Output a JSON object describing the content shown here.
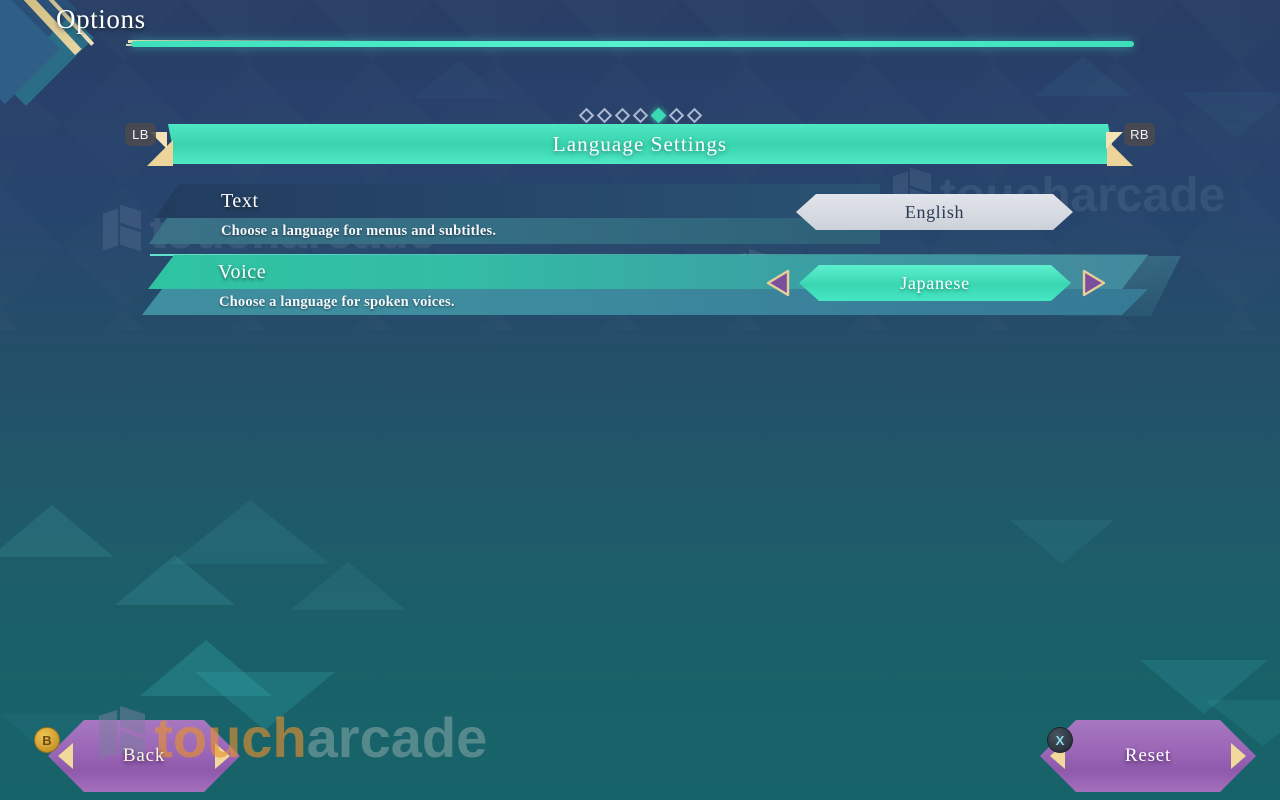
{
  "header": {
    "page_title": "Options",
    "category_title": "Language Settings",
    "left_bumper": "LB",
    "right_bumper": "RB",
    "tab_count": 7,
    "active_tab_index": 4
  },
  "settings": [
    {
      "id": "text",
      "label": "Text",
      "description": "Choose a language for menus and subtitles.",
      "value": "English",
      "selected": false
    },
    {
      "id": "voice",
      "label": "Voice",
      "description": "Choose a language for spoken voices.",
      "value": "Japanese",
      "selected": true
    }
  ],
  "stepper": {
    "prev_icon": "triangle-left-icon",
    "next_icon": "triangle-right-icon"
  },
  "footer": {
    "back_label": "Back",
    "back_badge": "B",
    "reset_label": "Reset",
    "reset_badge": "X"
  },
  "watermark": {
    "part_one": "touch",
    "part_two": "arcade",
    "logo_icon": "toucharcade-logo-icon"
  },
  "colors": {
    "accent_teal": "#3ad6b2",
    "banner_teal": "#46e6c4",
    "gold": "#ecd49a",
    "purple_button": "#9a66b6",
    "bg_top": "#283e64",
    "bg_bottom": "#17636a",
    "value_light": "#d6dae1"
  }
}
